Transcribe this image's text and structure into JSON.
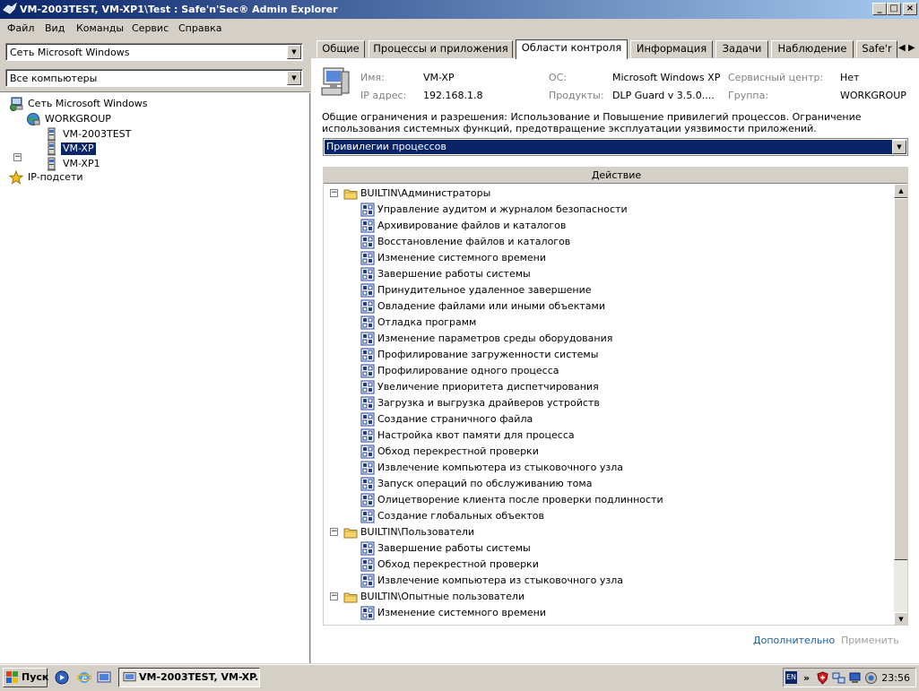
{
  "window": {
    "title": "VM-2003TEST, VM-XP1\\Test : Safe'n'Sec® Admin Explorer",
    "min": "_",
    "max": "□",
    "close": "×"
  },
  "menu": [
    "Файл",
    "Вид",
    "Команды",
    "Сервис",
    "Справка"
  ],
  "left": {
    "network_combo": "Сеть Microsoft Windows",
    "filter_combo": "Все компьютеры",
    "tree": {
      "root": "Сеть Microsoft Windows",
      "workgroup": "WORKGROUP",
      "computers": [
        "VM-2003TEST",
        "VM-XP",
        "VM-XP1"
      ],
      "ip": "IP-подсети",
      "expander_minus": "−"
    }
  },
  "tabs": [
    "Общие",
    "Процессы и приложения",
    "Области контроля",
    "Информация",
    "Задачи",
    "Наблюдение",
    "Safe'r"
  ],
  "active_tab": "Области контроля",
  "info": {
    "name_label": "Имя:",
    "name": "VM-XP",
    "os_label": "ОС:",
    "os": "Microsoft Windows XP",
    "service_label": "Сервисный центр:",
    "service": "Нет",
    "ip_label": "IP адрес:",
    "ip": "192.168.1.8",
    "products_label": "Продукты:",
    "products": "DLP Guard v 3.5.0....",
    "group_label": "Группа:",
    "group": "WORKGROUP"
  },
  "description": "Общие ограничения и разрешения: Использование и Повышение привилегий процессов. Ограничение использования системных функций, предотвращение эксплуатации уязвимости приложений.",
  "privilege_select": "Привилегии процессов",
  "column_header": "Действие",
  "groups": [
    {
      "name": "BUILTIN\\Администраторы",
      "items": [
        "Управление аудитом и журналом безопасности",
        "Архивирование файлов и каталогов",
        "Восстановление файлов и каталогов",
        "Изменение системного времени",
        "Завершение работы системы",
        "Принудительное удаленное завершение",
        "Овладение файлами или иными объектами",
        "Отладка программ",
        "Изменение параметров среды оборудования",
        "Профилирование загруженности системы",
        "Профилирование одного процесса",
        "Увеличение приоритета диспетчирования",
        "Загрузка и выгрузка драйверов устройств",
        "Создание страничного файла",
        "Настройка квот памяти для процесса",
        "Обход перекрестной проверки",
        "Извлечение компьютера из стыковочного узла",
        "Запуск операций по обслуживанию тома",
        "Олицетворение клиента после проверки подлинности",
        "Создание глобальных объектов"
      ]
    },
    {
      "name": "BUILTIN\\Пользователи",
      "items": [
        "Завершение работы системы",
        "Обход перекрестной проверки",
        "Извлечение компьютера из стыковочного узла"
      ]
    },
    {
      "name": "BUILTIN\\Опытные пользователи",
      "items": [
        "Изменение системного времени"
      ]
    }
  ],
  "links": {
    "more": "Дополнительно",
    "apply": "Применить"
  },
  "taskbar": {
    "start": "Пуск",
    "task": "VM-2003TEST, VM-XP...",
    "lang": "EN",
    "chevron": "»",
    "clock": "23:56"
  },
  "colors": {
    "title_start": "#0a246a",
    "title_end": "#a6caf0",
    "selection": "#0a246a",
    "link": "#2060a0",
    "folder": "#f5d46a",
    "privilege_icon": "#1c3f94"
  }
}
